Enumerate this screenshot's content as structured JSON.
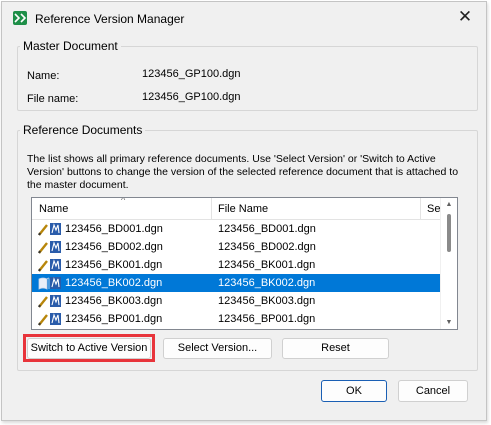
{
  "window": {
    "title": "Reference Version Manager",
    "close_glyph": "✕",
    "icon": "app-logo-icon",
    "accent": "#0078d7",
    "highlight_color": "#e8343b"
  },
  "master": {
    "legend": "Master Document",
    "name_label": "Name:",
    "name_value": "123456_GP100.dgn",
    "file_label": "File name:",
    "file_value": "123456_GP100.dgn"
  },
  "refs": {
    "legend": "Reference Documents",
    "description": "The list shows all primary reference documents. Use 'Select Version' or 'Switch to Active Version' buttons to change the version of the selected reference document that is attached to the master document.",
    "columns": [
      "Name",
      "File Name",
      "Se"
    ],
    "rows": [
      {
        "name": "123456_BD001.dgn",
        "file": "123456_BD001.dgn",
        "selected": false,
        "icon": "pencil-reference-icon"
      },
      {
        "name": "123456_BD002.dgn",
        "file": "123456_BD002.dgn",
        "selected": false,
        "icon": "pencil-reference-icon"
      },
      {
        "name": "123456_BK001.dgn",
        "file": "123456_BK001.dgn",
        "selected": false,
        "icon": "pencil-reference-icon"
      },
      {
        "name": "123456_BK002.dgn",
        "file": "123456_BK002.dgn",
        "selected": true,
        "icon": "book-reference-icon"
      },
      {
        "name": "123456_BK003.dgn",
        "file": "123456_BK003.dgn",
        "selected": false,
        "icon": "pencil-reference-icon"
      },
      {
        "name": "123456_BP001.dgn",
        "file": "123456_BP001.dgn",
        "selected": false,
        "icon": "pencil-reference-icon"
      }
    ]
  },
  "buttons": {
    "switch": "Switch to Active Version",
    "select": "Select Version...",
    "reset": "Reset",
    "ok": "OK",
    "cancel": "Cancel"
  }
}
